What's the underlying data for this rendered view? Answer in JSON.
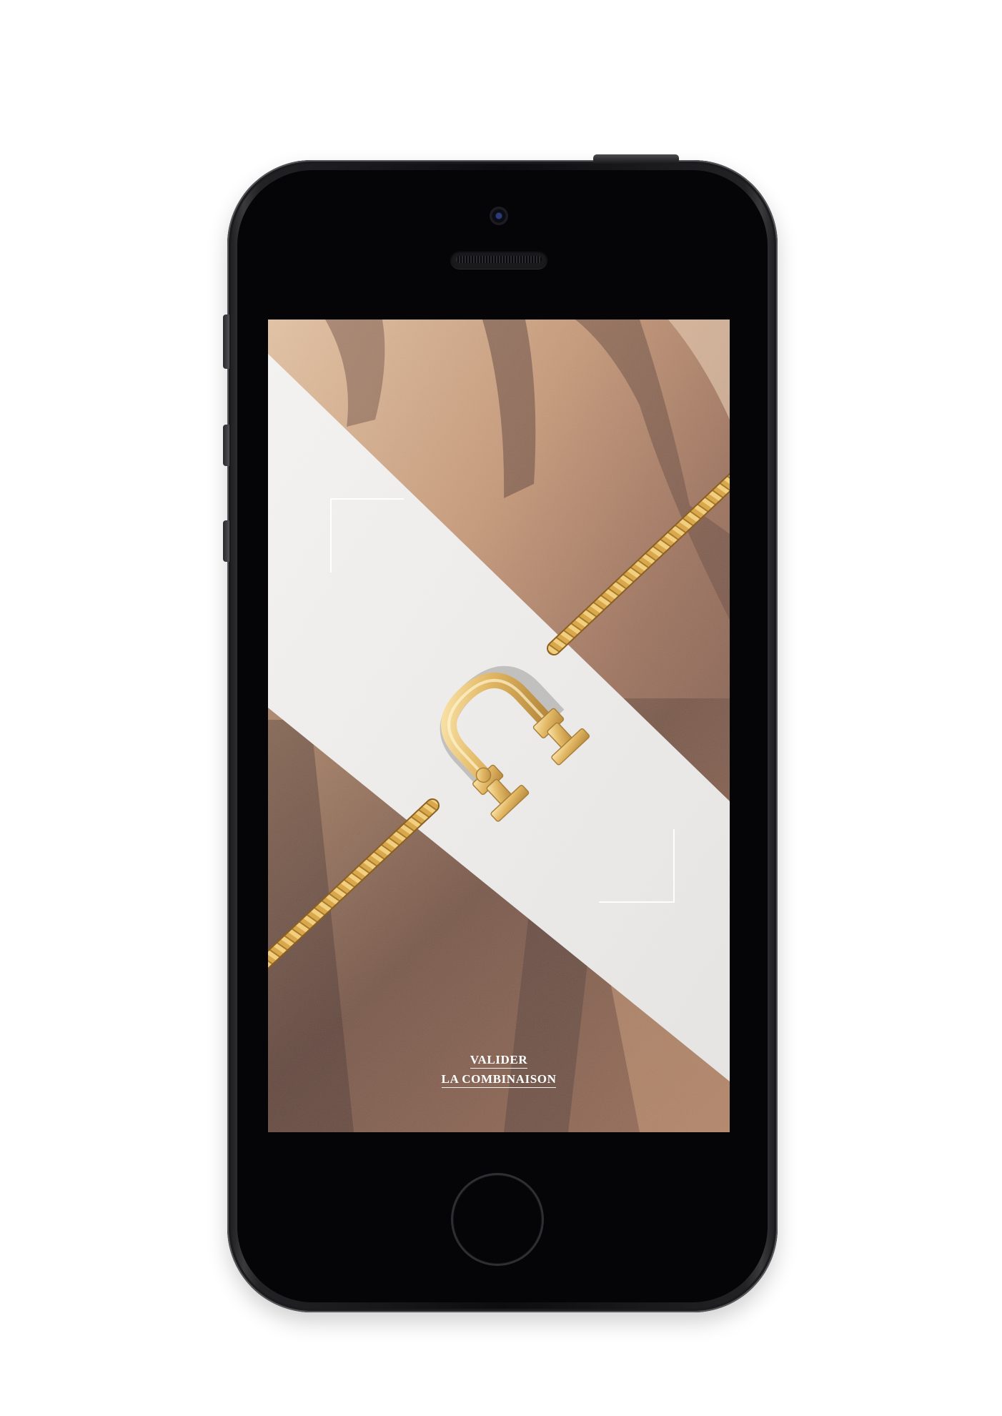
{
  "app": {
    "confirm_line1": "VALIDER",
    "confirm_line2": "LA COMBINAISON"
  },
  "colors": {
    "gold": "#d9a74c",
    "metallic_bronze": "#8a6350",
    "white_band": "#efeeec",
    "phone_body": "#1c1c1e"
  },
  "icons": {
    "bracelet": "gold-rope-bracelet-with-horseshoe-clasp",
    "frame_corners": "viewfinder-corner-brackets"
  }
}
